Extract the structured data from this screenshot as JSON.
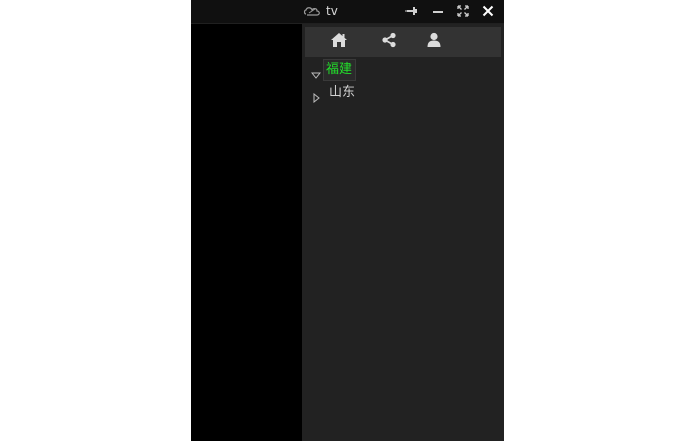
{
  "window": {
    "title": "tv"
  },
  "titlebar_buttons": [
    {
      "name": "pin-button",
      "icon": "pin-icon"
    },
    {
      "name": "minimize-button",
      "icon": "minimize-icon"
    },
    {
      "name": "fullscreen-button",
      "icon": "fullscreen-icon"
    },
    {
      "name": "close-button",
      "icon": "close-icon"
    }
  ],
  "panel_toolbar": [
    {
      "name": "home-button",
      "icon": "home-icon"
    },
    {
      "name": "share-button",
      "icon": "share-icon"
    },
    {
      "name": "user-button",
      "icon": "user-icon"
    }
  ],
  "tree": {
    "items": [
      {
        "label": "福建",
        "expanded": true,
        "selected": true
      },
      {
        "label": "山东",
        "expanded": false,
        "selected": false
      }
    ]
  },
  "colors": {
    "titlebar_bg": "#101010",
    "panel_bg": "#222222",
    "toolbar_bg": "#333333",
    "selected_text": "#22e02a",
    "normal_text": "#d0d0d0"
  }
}
